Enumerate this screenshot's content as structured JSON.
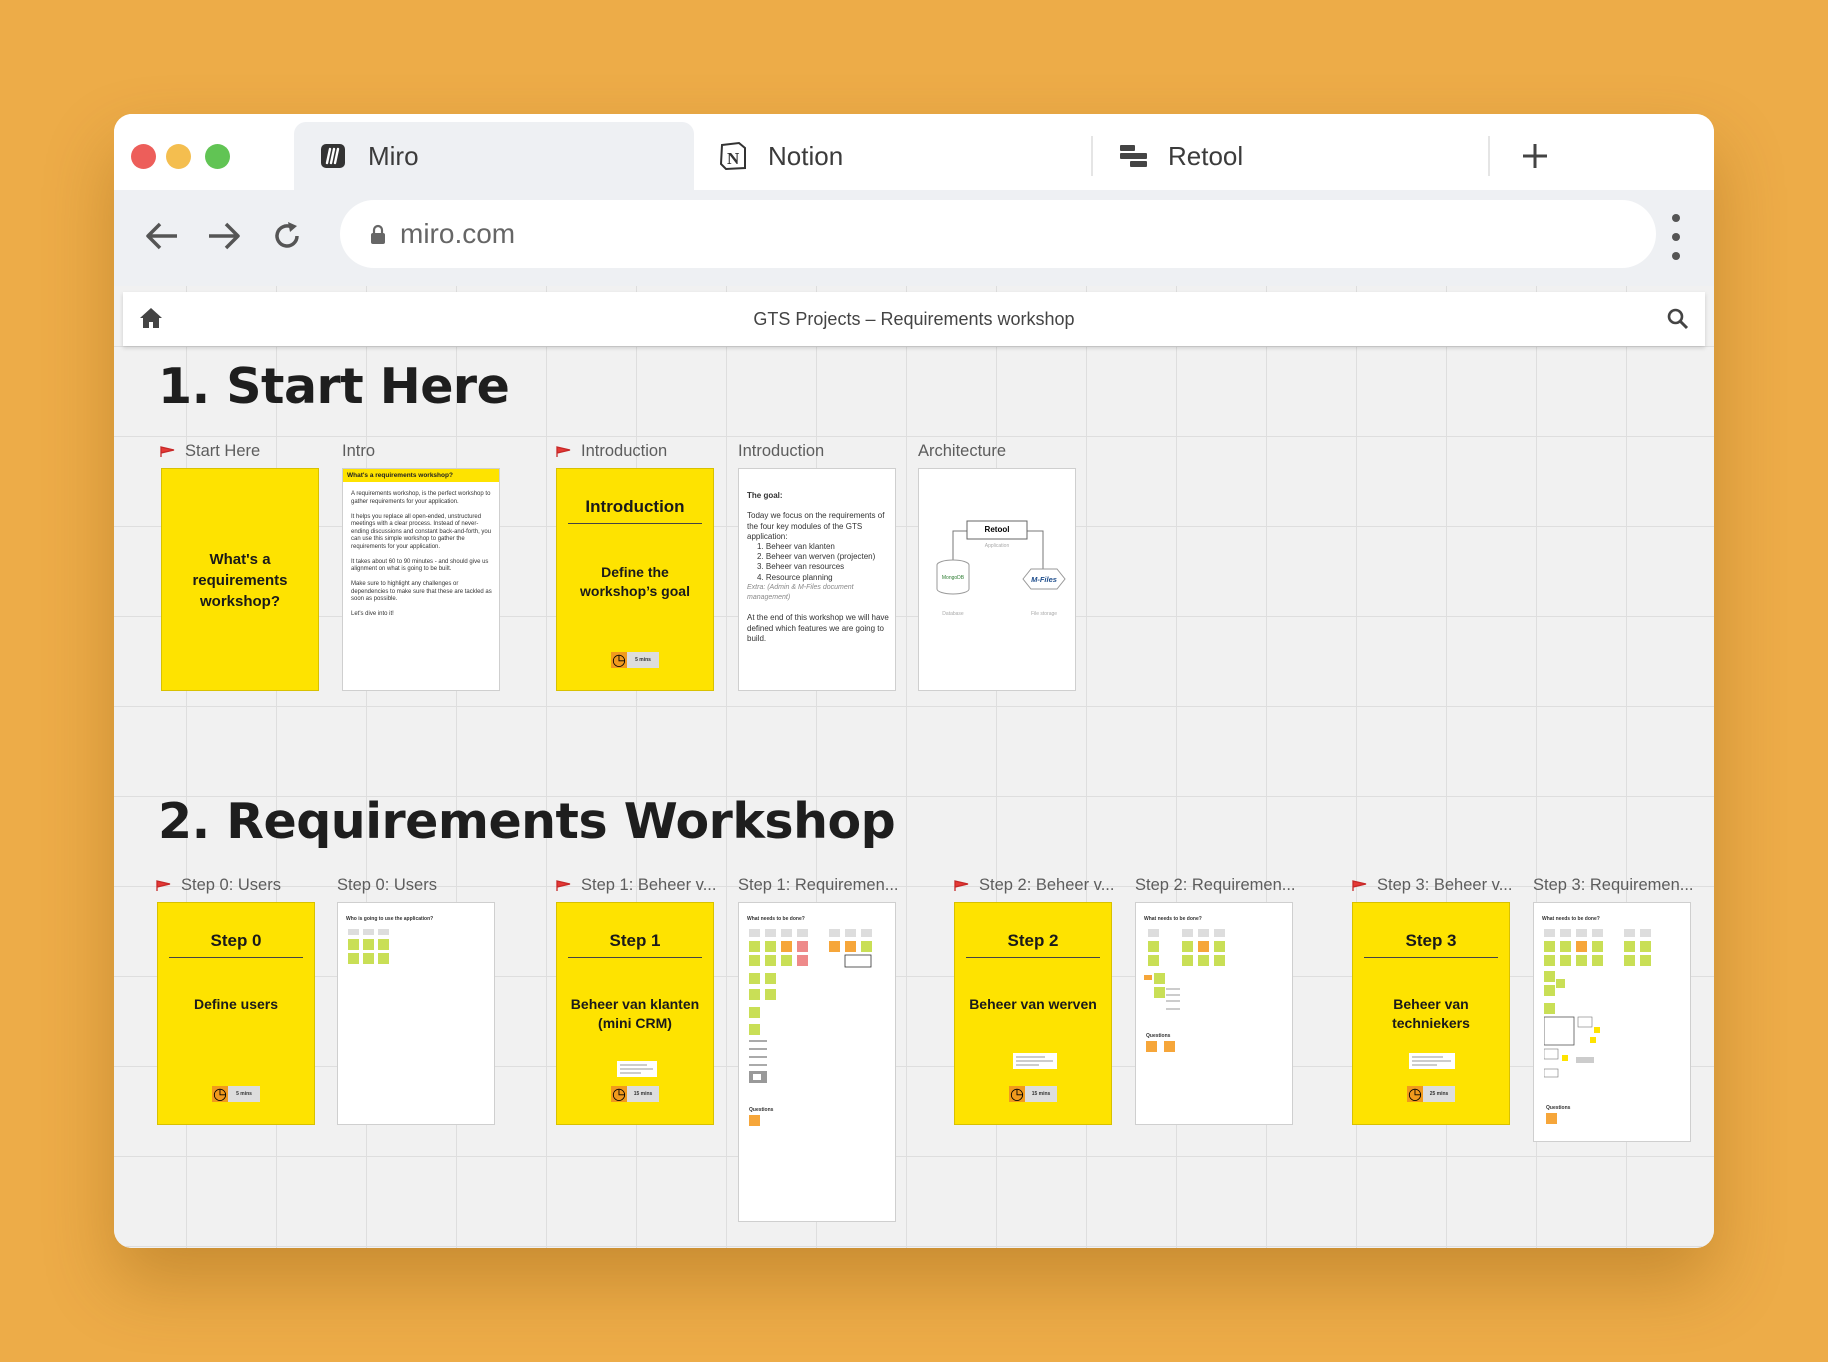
{
  "browser": {
    "tabs": [
      {
        "label": "Miro",
        "icon": "miro-icon",
        "active": true
      },
      {
        "label": "Notion",
        "icon": "notion-icon",
        "active": false
      },
      {
        "label": "Retool",
        "icon": "retool-icon",
        "active": false
      }
    ],
    "url": "miro.com"
  },
  "board": {
    "title": "GTS Projects – Requirements workshop",
    "section1_title": "1. Start Here",
    "section2_title": "2. Requirements Workshop",
    "frames_row1": [
      {
        "label": "Start Here",
        "flag": true
      },
      {
        "label": "Intro",
        "flag": false
      },
      {
        "label": "Introduction",
        "flag": true
      },
      {
        "label": "Introduction",
        "flag": false
      },
      {
        "label": "Architecture",
        "flag": false
      }
    ],
    "frames_row2": [
      {
        "label": "Step 0: Users",
        "flag": true
      },
      {
        "label": "Step 0: Users",
        "flag": false
      },
      {
        "label": "Step 1: Beheer v...",
        "flag": true
      },
      {
        "label": "Step 1: Requiremen...",
        "flag": false
      },
      {
        "label": "Step 2: Beheer v...",
        "flag": true
      },
      {
        "label": "Step 2: Requiremen...",
        "flag": false
      },
      {
        "label": "Step 3: Beheer v...",
        "flag": true
      },
      {
        "label": "Step 3: Requiremen...",
        "flag": false
      }
    ],
    "start_card": {
      "text": "What's a requirements workshop?"
    },
    "intro_doc": {
      "header": "What's a requirements workshop?",
      "p1": "A requirements workshop, is the perfect workshop to gather requirements for your application.",
      "p2": "It helps you replace all open-ended, unstructured meetings with a clear process. Instead of never-ending discussions and constant back-and-forth, you can use this simple workshop to gather the requirements for your application.",
      "p3": "It takes about 60 to 90 minutes - and should give us alignment on what is going to be built.",
      "p4": "Make sure to highlight any challenges or dependencies to make sure that these are tackled as soon as possible.",
      "p5": "Let's dive into it!"
    },
    "intro_card": {
      "title": "Introduction",
      "body": "Define the workshop’s goal",
      "timer": "5 mins"
    },
    "goal_doc": {
      "heading": "The goal:",
      "p1": "Today we focus on the requirements of the four key modules of the GTS application:",
      "items": [
        "Beheer van klanten",
        "Beheer van werven (projecten)",
        "Beheer van resources",
        "Resource planning"
      ],
      "extra": "Extra: (Admin & M-Files document management)",
      "p2": "At the end of this workshop we will have defined which features we are going to build."
    },
    "architecture": {
      "app": "Retool",
      "app_caption": "Application",
      "db": "MongoDB",
      "db_caption": "Database",
      "files": "M-Files",
      "files_caption": "File storage"
    },
    "step_cards": [
      {
        "title": "Step 0",
        "body": "Define users",
        "timer": "5 mins"
      },
      {
        "title": "Step 1",
        "body": "Beheer van klanten (mini CRM)",
        "timer": "15 mins"
      },
      {
        "title": "Step 2",
        "body": "Beheer van werven",
        "timer": "15 mins"
      },
      {
        "title": "Step 3",
        "body": "Beheer van techniekers",
        "timer": "25 mins"
      }
    ],
    "users_doc": {
      "heading": "Who is going to use the application?"
    },
    "req_docs": {
      "heading": "What needs to be done?",
      "questions": "Questions"
    }
  },
  "colors": {
    "background": "#EDAC48",
    "sticky_yellow": "#FEE300",
    "sticky_green": "#C9DF56",
    "sticky_orange": "#F6A63A",
    "sticky_red": "#EE8A8A"
  }
}
